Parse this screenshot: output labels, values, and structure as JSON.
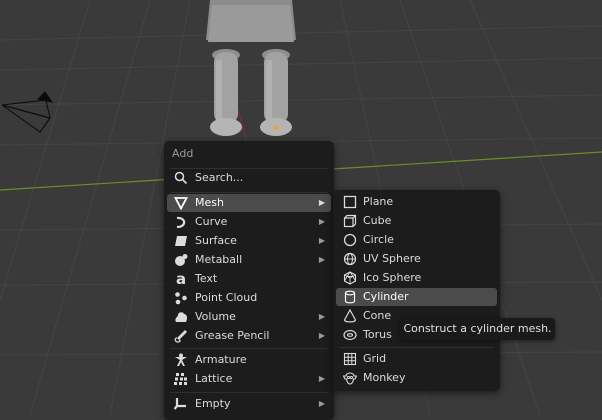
{
  "add_menu": {
    "title": "Add",
    "search_label": "Search...",
    "items": [
      {
        "label": "Mesh",
        "icon": "mesh-icon",
        "submenu": true
      },
      {
        "label": "Curve",
        "icon": "curve-icon",
        "submenu": true
      },
      {
        "label": "Surface",
        "icon": "surface-icon",
        "submenu": true
      },
      {
        "label": "Metaball",
        "icon": "metaball-icon",
        "submenu": true
      },
      {
        "label": "Text",
        "icon": "text-icon",
        "submenu": false
      },
      {
        "label": "Point Cloud",
        "icon": "point-cloud-icon",
        "submenu": false
      },
      {
        "label": "Volume",
        "icon": "volume-icon",
        "submenu": true
      },
      {
        "label": "Grease Pencil",
        "icon": "grease-pencil-icon",
        "submenu": true
      },
      {
        "label": "Armature",
        "icon": "armature-icon",
        "submenu": false
      },
      {
        "label": "Lattice",
        "icon": "lattice-icon",
        "submenu": true
      },
      {
        "label": "Empty",
        "icon": "empty-icon",
        "submenu": true
      }
    ]
  },
  "mesh_menu": {
    "items": [
      {
        "label": "Plane",
        "icon": "plane-icon"
      },
      {
        "label": "Cube",
        "icon": "cube-icon"
      },
      {
        "label": "Circle",
        "icon": "circle-icon"
      },
      {
        "label": "UV Sphere",
        "icon": "uv-sphere-icon"
      },
      {
        "label": "Ico Sphere",
        "icon": "ico-sphere-icon"
      },
      {
        "label": "Cylinder",
        "icon": "cylinder-icon"
      },
      {
        "label": "Cone",
        "icon": "cone-icon"
      },
      {
        "label": "Torus",
        "icon": "torus-icon"
      },
      {
        "label": "Grid",
        "icon": "grid-icon"
      },
      {
        "label": "Monkey",
        "icon": "monkey-icon"
      }
    ]
  },
  "tooltip": {
    "text": "Construct a cylinder mesh."
  },
  "colors": {
    "viewport_bg": "#3a3a3a",
    "grid_line": "#454545",
    "x_axis": "#7a2e35",
    "y_axis": "#6a8f25",
    "menu_bg": "#1c1c1c",
    "highlight": "#4b4b4b"
  }
}
